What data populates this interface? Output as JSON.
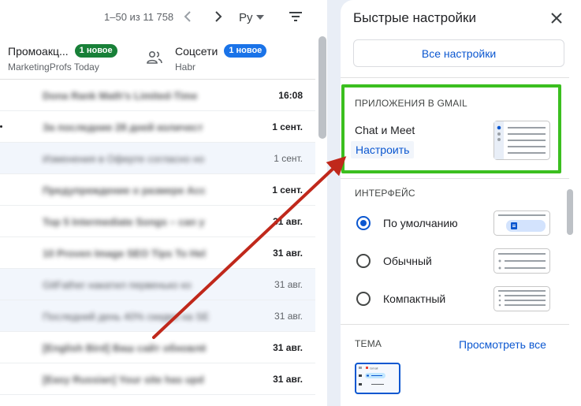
{
  "toolbar": {
    "range_text": "1–50 из 11 758",
    "lang_label": "Ру",
    "prev_icon": "chevron-left-icon",
    "next_icon": "chevron-right-icon",
    "filter_icon": "filter-icon"
  },
  "tabs": [
    {
      "title": "Промоакц...",
      "badge": "1 новое",
      "badge_color": "#188038",
      "subtitle": "MarketingProfs Today"
    },
    {
      "title": "Соцсети",
      "badge": "1 новое",
      "badge_color": "#1a73e8",
      "subtitle": "Habr",
      "icon": "people-icon"
    }
  ],
  "rows": [
    {
      "subject": "Dona Rank Math's Limited-Time",
      "date": "16:08",
      "unread": true
    },
    {
      "subject": "За последние 28 дней количест",
      "date": "1 сент.",
      "unread": true
    },
    {
      "subject": "Изменения в Оферте согласно но",
      "date": "1 сент.",
      "unread": false
    },
    {
      "subject": "Предупреждение о размере Acc",
      "date": "1 сент.",
      "unread": true
    },
    {
      "subject": "Top 5 Intermediate Songs – can y",
      "date": "31 авг.",
      "unread": true
    },
    {
      "subject": "10 Proven Image SEO Tips To Hel",
      "date": "31 авг.",
      "unread": true
    },
    {
      "subject": "GitFather накатил первенько ко",
      "date": "31 авг.",
      "unread": false
    },
    {
      "subject": "Последний день 40% скидки на SE",
      "date": "31 авг.",
      "unread": false
    },
    {
      "subject": "[English Bird] Ваш сайт обновлё",
      "date": "31 авг.",
      "unread": true
    },
    {
      "subject": "[Easy Russian] Your site has upd",
      "date": "31 авг.",
      "unread": true
    }
  ],
  "quick_settings": {
    "title": "Быстрые настройки",
    "close_icon": "close-icon",
    "all_settings_label": "Все настройки",
    "apps_section": {
      "label": "ПРИЛОЖЕНИЯ В GMAIL",
      "name": "Chat и Meet",
      "configure_label": "Настроить"
    },
    "view_section": {
      "label": "ИНТЕРФЕЙС",
      "options": [
        {
          "label": "По умолчанию",
          "selected": true
        },
        {
          "label": "Обычный",
          "selected": false
        },
        {
          "label": "Компактный",
          "selected": false
        }
      ]
    },
    "theme_section": {
      "label": "ТЕМА",
      "view_all_label": "Просмотреть все",
      "thumb_text": "Gmail"
    }
  },
  "colors": {
    "accent": "#0b57d0",
    "highlight": "#3bbf1f",
    "annotation_arrow": "#c0281b"
  }
}
